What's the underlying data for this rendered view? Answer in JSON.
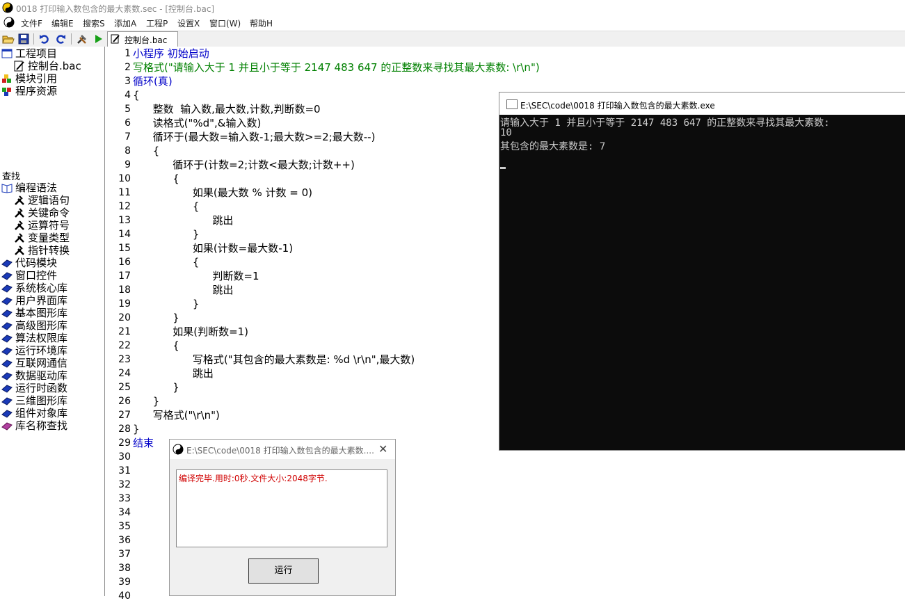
{
  "window": {
    "title": "0018 打印输入数包含的最大素数.sec - [控制台.bac]"
  },
  "menu": [
    "文件F",
    "编辑E",
    "搜索S",
    "添加A",
    "工程P",
    "设置X",
    "窗口(W)",
    "帮助H"
  ],
  "tab": {
    "label": "控制台.bac"
  },
  "sidebar": {
    "project": [
      {
        "label": "工程项目"
      },
      {
        "label": "控制台.bac"
      },
      {
        "label": "模块引用"
      },
      {
        "label": "程序资源"
      }
    ],
    "find_label": "查找",
    "library": [
      {
        "label": "编程语法"
      },
      {
        "label": "逻辑语句"
      },
      {
        "label": "关键命令"
      },
      {
        "label": "运算符号"
      },
      {
        "label": "变量类型"
      },
      {
        "label": "指针转换"
      },
      {
        "label": "代码模块"
      },
      {
        "label": "窗口控件"
      },
      {
        "label": "系统核心库"
      },
      {
        "label": "用户界面库"
      },
      {
        "label": "基本图形库"
      },
      {
        "label": "高级图形库"
      },
      {
        "label": "算法权限库"
      },
      {
        "label": "运行环境库"
      },
      {
        "label": "互联网通信"
      },
      {
        "label": "数据驱动库"
      },
      {
        "label": "运行时函数"
      },
      {
        "label": "三维图形库"
      },
      {
        "label": "组件对象库"
      },
      {
        "label": "库名称查找"
      }
    ]
  },
  "editor": {
    "line_numbers": [
      "1",
      "2",
      "3",
      "4",
      "5",
      "6",
      "7",
      "8",
      "9",
      "10",
      "11",
      "12",
      "13",
      "14",
      "15",
      "16",
      "17",
      "18",
      "19",
      "20",
      "21",
      "22",
      "23",
      "24",
      "25",
      "26",
      "27",
      "28",
      "29",
      "30",
      "31",
      "32",
      "33",
      "34",
      "35",
      "36",
      "37",
      "38",
      "39",
      "40"
    ],
    "code_lines": [
      "小程序 初始启动",
      "写格式(\"请输入大于 1 并且小于等于 2147 483 647 的正整数来寻找其最大素数: \\r\\n\")",
      "循环(真)",
      "{",
      "      整数  输入数,最大数,计数,判断数=0",
      "      读格式(\"%d\",&输入数)",
      "      循环于(最大数=输入数-1;最大数>=2;最大数--)",
      "      {",
      "            循环于(计数=2;计数<最大数;计数++)",
      "            {",
      "                  如果(最大数 % 计数 = 0)",
      "                  {",
      "                        跳出",
      "                  }",
      "                  如果(计数=最大数-1)",
      "                  {",
      "                        判断数=1",
      "                        跳出",
      "                  }",
      "            }",
      "            如果(判断数=1)",
      "            {",
      "                  写格式(\"其包含的最大素数是: %d \\r\\n\",最大数)",
      "                  跳出",
      "            }",
      "      }",
      "      写格式(\"\\r\\n\")",
      "}",
      "结束"
    ]
  },
  "console": {
    "title": "E:\\SEC\\code\\0018 打印输入数包含的最大素数.exe",
    "lines": [
      "请输入大于 1 并且小于等于 2147 483 647 的正整数来寻找其最大素数:",
      "10",
      "其包含的最大素数是: 7"
    ]
  },
  "compile_dialog": {
    "title": "E:\\SEC\\code\\0018 打印输入数包含的最大素数....",
    "output": "编译完毕.用时:0秒.文件大小:2048字节.",
    "run_label": "运行"
  },
  "colors": {
    "keyword": "#0000c8",
    "string": "#008000",
    "number": "#e00000",
    "console_bg": "#0c0c0c",
    "compile_msg": "#d00000"
  }
}
